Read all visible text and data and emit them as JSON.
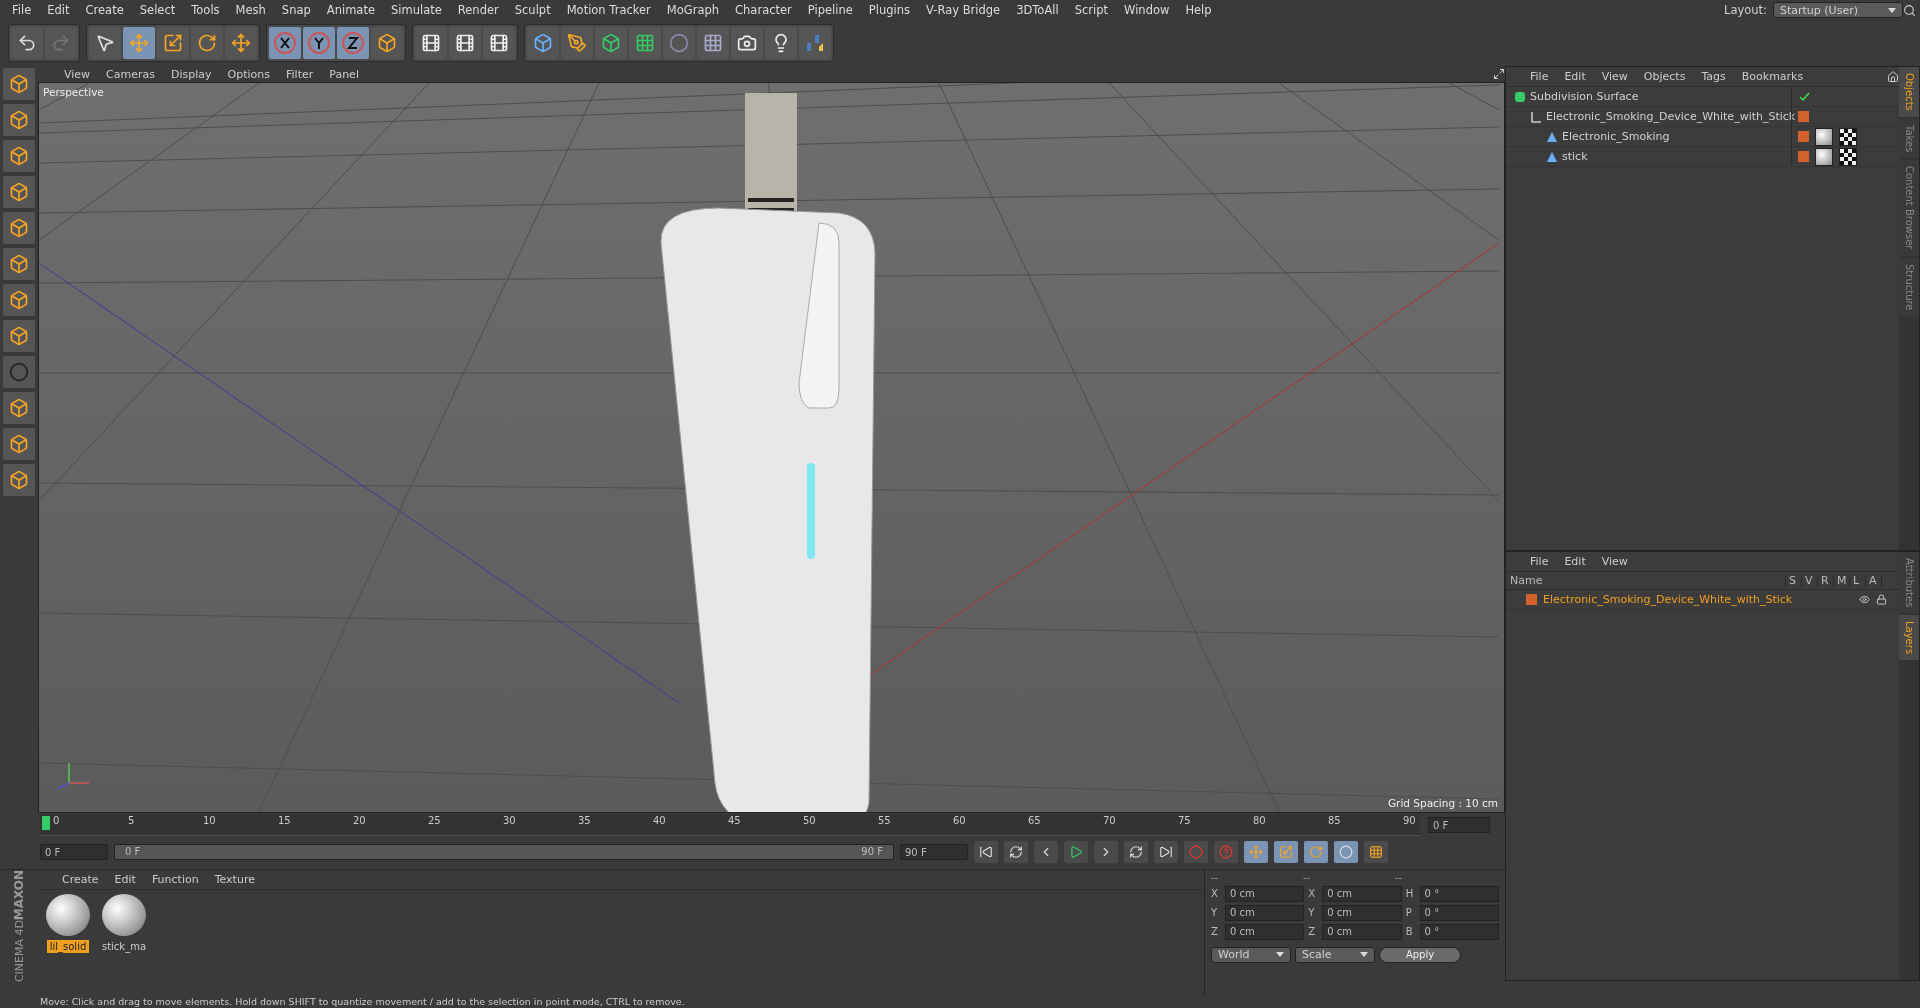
{
  "menu": [
    "File",
    "Edit",
    "Create",
    "Select",
    "Tools",
    "Mesh",
    "Snap",
    "Animate",
    "Simulate",
    "Render",
    "Sculpt",
    "Motion Tracker",
    "MoGraph",
    "Character",
    "Pipeline",
    "Plugins",
    "V-Ray Bridge",
    "3DToAll",
    "Script",
    "Window",
    "Help"
  ],
  "layout": {
    "label": "Layout:",
    "value": "Startup (User)"
  },
  "viewport": {
    "menu": [
      "View",
      "Cameras",
      "Display",
      "Options",
      "Filter",
      "Panel"
    ],
    "camera": "Perspective",
    "grid_spacing": "Grid Spacing : 10 cm"
  },
  "object_manager": {
    "menu": [
      "File",
      "Edit",
      "View",
      "Objects",
      "Tags",
      "Bookmarks"
    ],
    "objects": [
      {
        "name": "Subdivision Surface",
        "kind": "subdivision",
        "tags": false,
        "children": [
          {
            "name": "Electronic_Smoking_Device_White_with_Stick",
            "kind": "null",
            "tags": false,
            "children": [
              {
                "name": "Electronic_Smoking",
                "kind": "mesh",
                "tags": true
              },
              {
                "name": "stick",
                "kind": "mesh",
                "tags": true
              }
            ]
          }
        ]
      }
    ]
  },
  "side_tabs_top": [
    {
      "label": "Objects",
      "selected": true
    },
    {
      "label": "Takes",
      "selected": false
    },
    {
      "label": "Content Browser",
      "selected": false
    },
    {
      "label": "Structure",
      "selected": false
    }
  ],
  "side_tabs_bottom": [
    {
      "label": "Attributes",
      "selected": false
    },
    {
      "label": "Layers",
      "selected": true
    }
  ],
  "layer_manager": {
    "menu": [
      "File",
      "Edit",
      "View"
    ],
    "columns": [
      "Name",
      "S",
      "V",
      "R",
      "M",
      "L",
      "A"
    ],
    "rows": [
      {
        "name": "Electronic_Smoking_Device_White_with_Stick",
        "color": "#d2622a"
      }
    ]
  },
  "timeline": {
    "ticks": [
      "0",
      "5",
      "10",
      "15",
      "20",
      "25",
      "30",
      "35",
      "40",
      "45",
      "50",
      "55",
      "60",
      "65",
      "70",
      "75",
      "80",
      "85",
      "90"
    ],
    "level": 0,
    "current_frame": "0 F",
    "start_field": "0 F",
    "range": {
      "start": "0 F",
      "end": "90 F",
      "level": 1
    },
    "end_field": "90 F"
  },
  "material_manager": {
    "menu": [
      "Create",
      "Edit",
      "Function",
      "Texture"
    ],
    "materials": [
      {
        "name": "lil_solid",
        "selected": true
      },
      {
        "name": "stick_ma",
        "selected": false
      }
    ]
  },
  "brand": {
    "maker": "MAXON",
    "product": "CINEMA 4D"
  },
  "coordinates": {
    "headers": [
      "--",
      "--",
      "--"
    ],
    "rows": [
      [
        {
          "axis": "X",
          "value": "0 cm"
        },
        {
          "axis": "X",
          "value": "0 cm"
        },
        {
          "axis": "H",
          "value": "0 °"
        }
      ],
      [
        {
          "axis": "Y",
          "value": "0 cm"
        },
        {
          "axis": "Y",
          "value": "0 cm"
        },
        {
          "axis": "P",
          "value": "0 °"
        }
      ],
      [
        {
          "axis": "Z",
          "value": "0 cm"
        },
        {
          "axis": "Z",
          "value": "0 cm"
        },
        {
          "axis": "B",
          "value": "0 °"
        }
      ]
    ],
    "mode": "World",
    "transform": "Scale",
    "apply": "Apply"
  },
  "status": "Move: Click and drag to move elements. Hold down SHIFT to quantize movement / add to the selection in point mode, CTRL to remove."
}
